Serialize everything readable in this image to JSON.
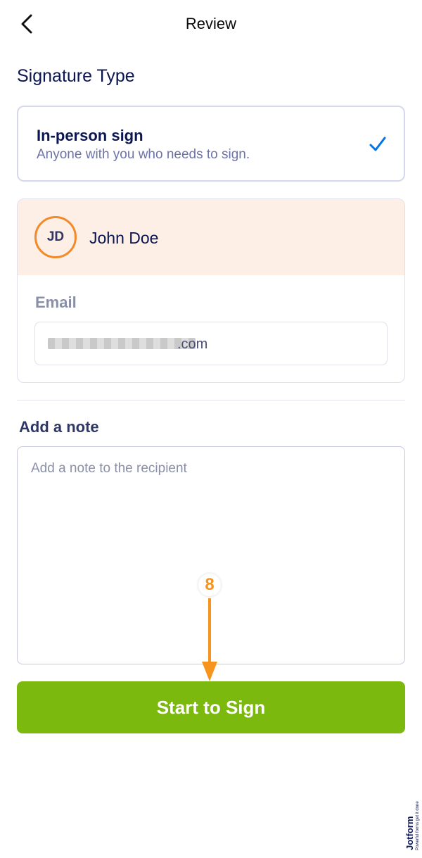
{
  "header": {
    "title": "Review"
  },
  "signature_type": {
    "section_title": "Signature Type",
    "option_title": "In-person sign",
    "option_subtitle": "Anyone with you who needs to sign.",
    "selected": true
  },
  "signer": {
    "initials": "JD",
    "name": "John Doe",
    "email_label": "Email",
    "email_visible_suffix": ".com"
  },
  "note": {
    "label": "Add a note",
    "placeholder": "Add a note to the recipient",
    "value": ""
  },
  "annotation": {
    "step_number": "8"
  },
  "actions": {
    "start_label": "Start to Sign"
  },
  "branding": {
    "logo_text": "Jotform",
    "tagline": "Powerful forms get it done"
  },
  "colors": {
    "primary_text": "#0a1551",
    "accent_check": "#0075e3",
    "avatar_ring": "#f28a2a",
    "signer_header_bg": "#fdeee6",
    "button_green": "#7cb90e",
    "annotation_orange": "#f7941d"
  },
  "icons": {
    "back": "chevron-left-icon",
    "selected": "checkmark-icon",
    "pointer": "arrow-down-icon"
  }
}
